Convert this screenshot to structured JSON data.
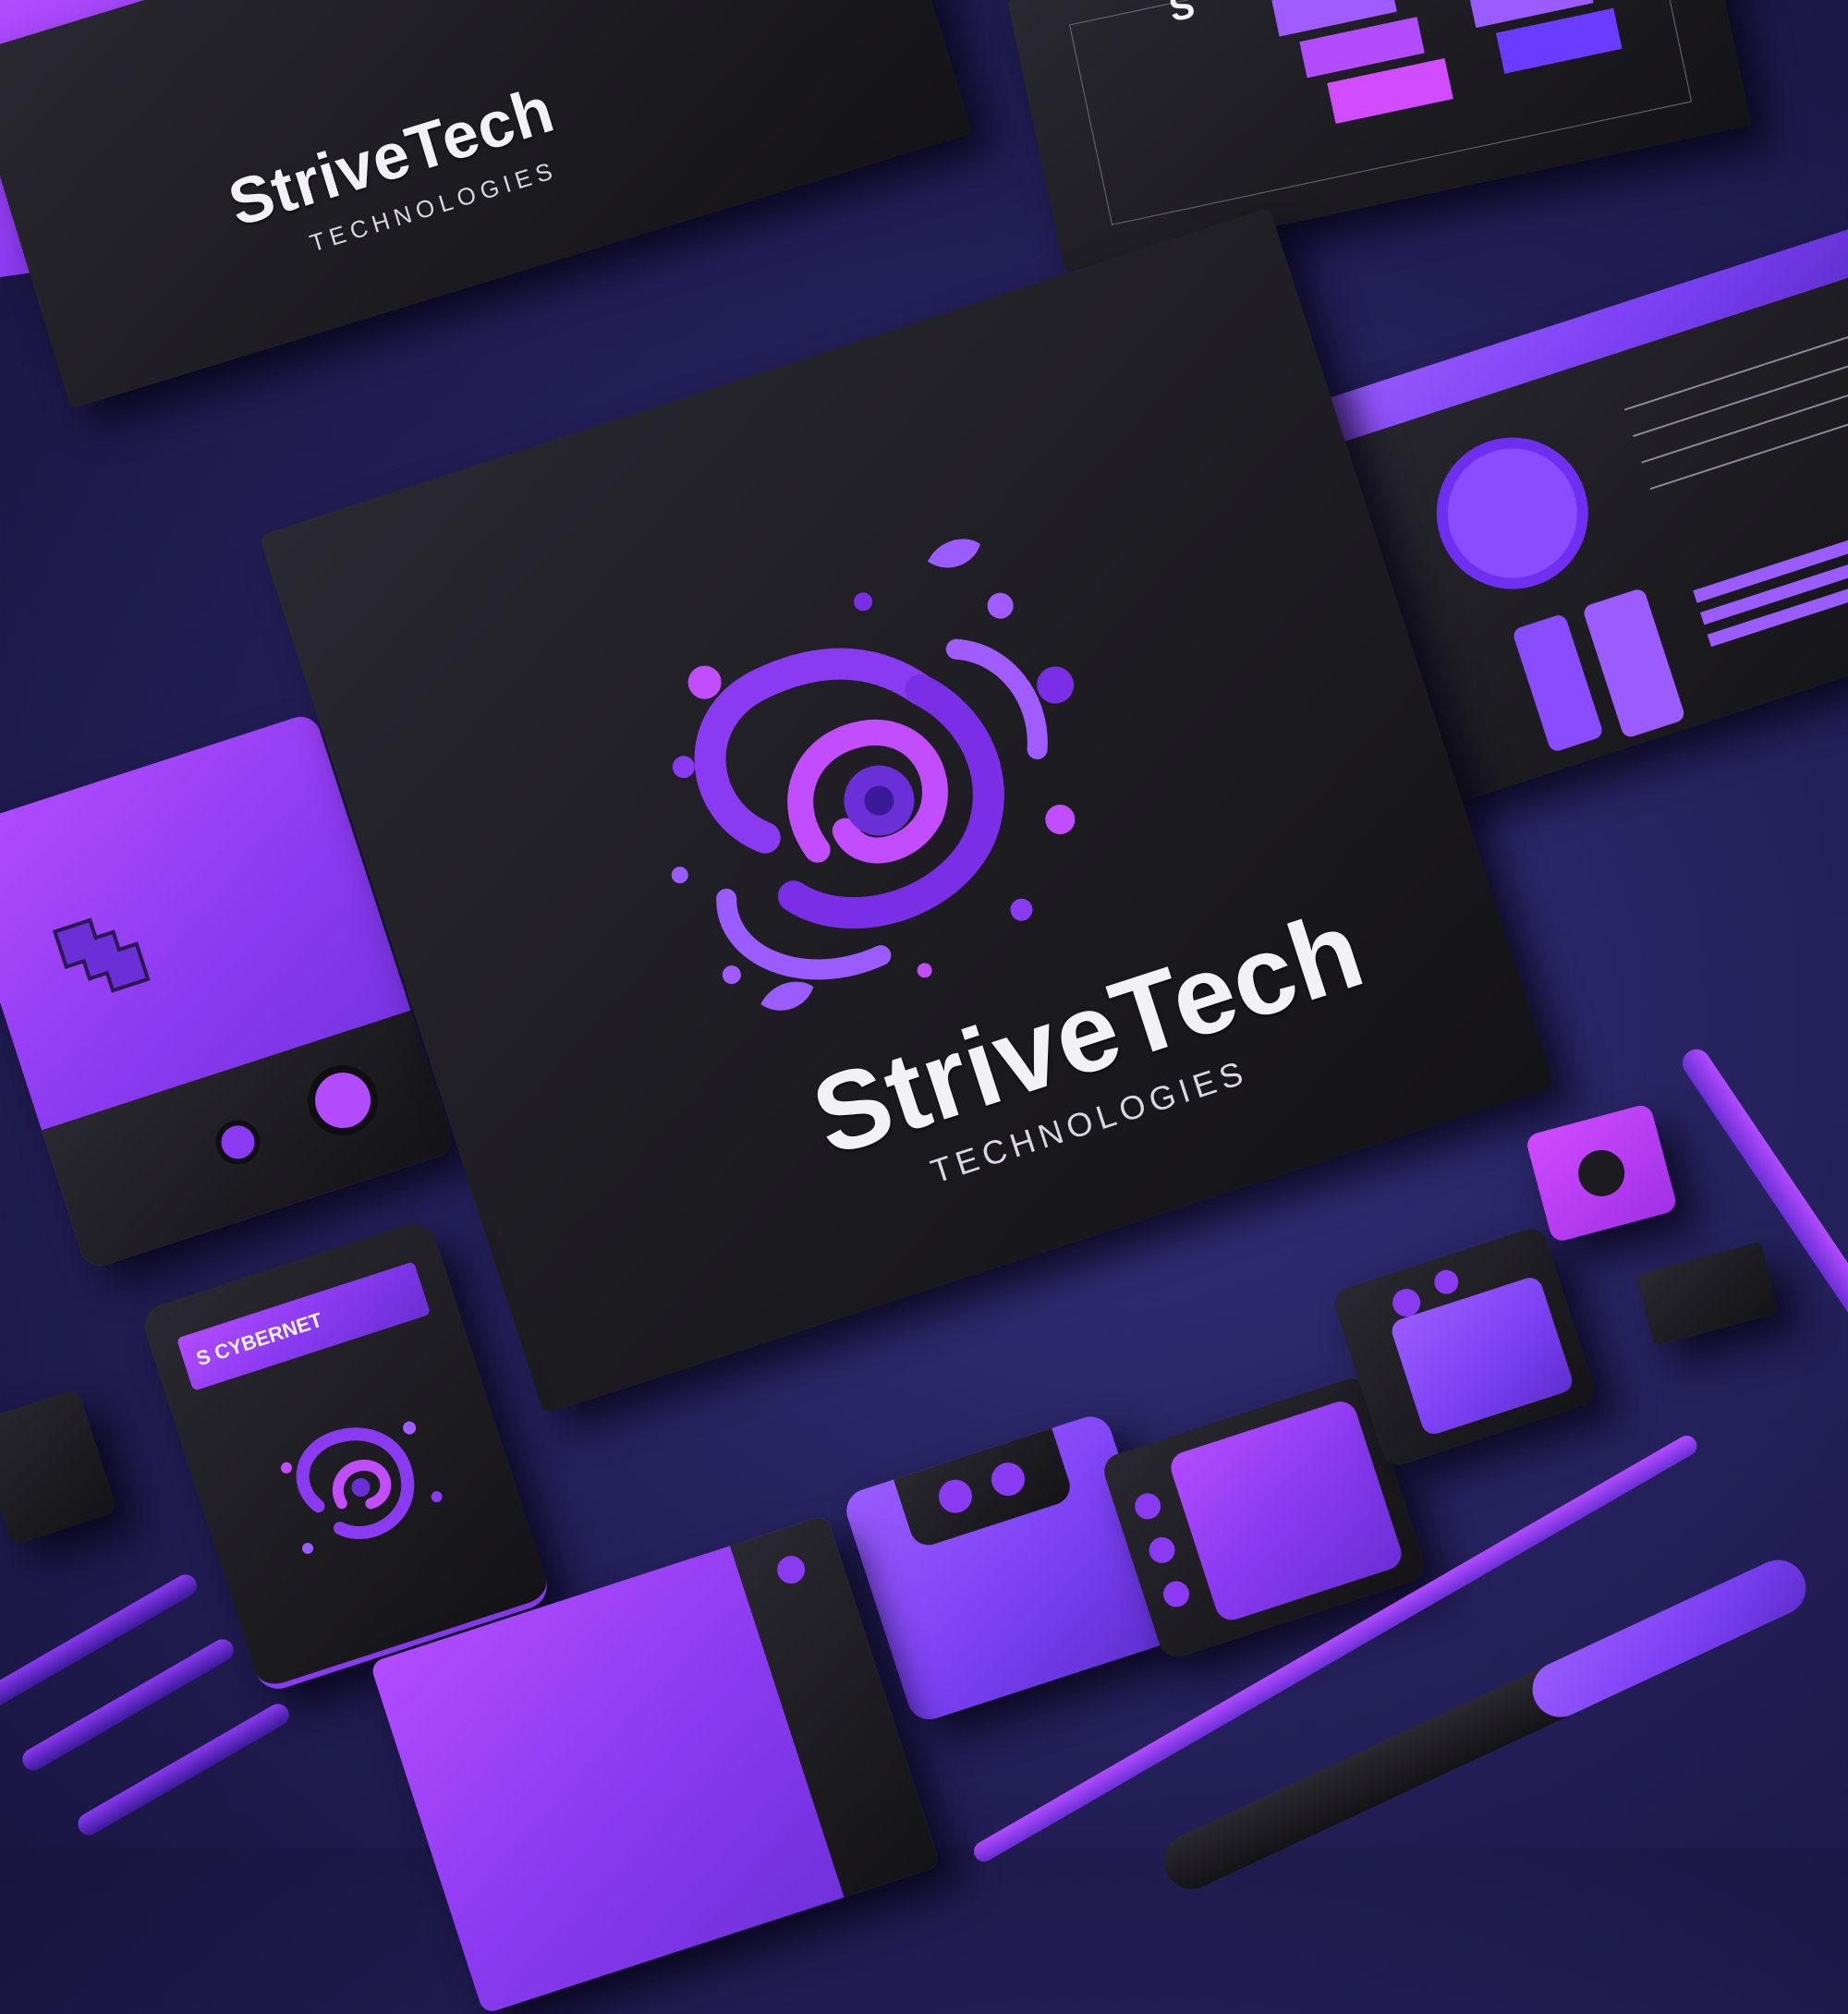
{
  "brand": {
    "name": "StriveTech",
    "tagline": "TECHNOLOGIES"
  },
  "small_card": {
    "label": "S CYBERNET"
  },
  "colors": {
    "background": "#25215c",
    "black_material": "#1f1e23",
    "purple_primary": "#8a3af0",
    "magenta_accent": "#c24dff",
    "text_white": "#f2f1f6"
  },
  "icons": {
    "main_logo": "abstract-purple-swirl-logo-icon",
    "leaf": "leaf-icon"
  }
}
